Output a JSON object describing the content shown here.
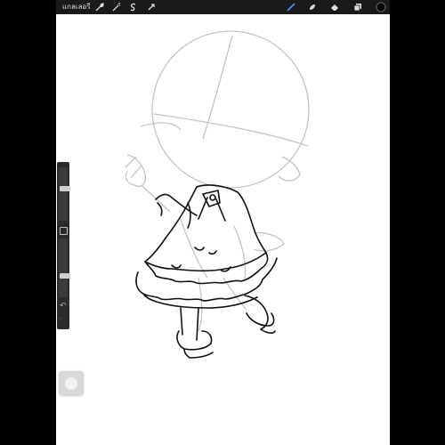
{
  "toolbar": {
    "gallery_label": "แกลเลอรี",
    "left_tools": [
      "wrench-icon",
      "magic-wand-icon",
      "selection-icon",
      "transform-icon"
    ],
    "right_tools": [
      "brush-icon",
      "smudge-icon",
      "eraser-icon",
      "layers-icon",
      "color-icon"
    ],
    "active_tool": "brush-icon",
    "accent_color": "#4d8df5",
    "current_color": "#000000"
  },
  "sidebar": {
    "brush_size": 0.62,
    "opacity": 0.35,
    "undo_icon": "↶",
    "redo_icon": "·"
  },
  "canvas": {
    "background": "#ffffff",
    "sketch_color": "#c4c4c4",
    "ink_color": "#111111"
  }
}
